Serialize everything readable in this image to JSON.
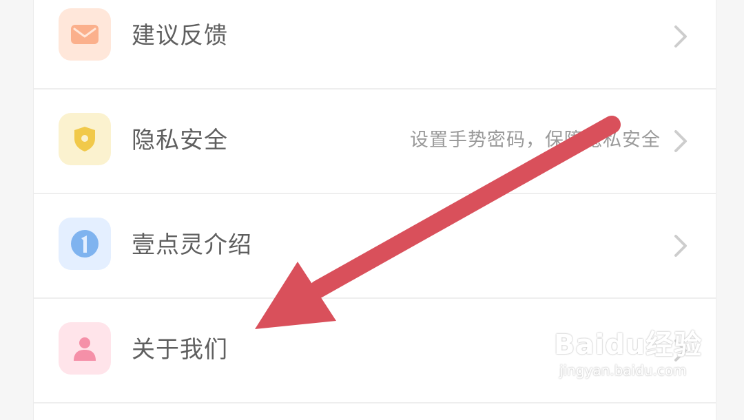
{
  "menu": {
    "items": [
      {
        "label": "建议反馈",
        "subtitle": "",
        "icon": "mail-icon",
        "icon_bg": "#ffe7da",
        "icon_color": "#fbb08c"
      },
      {
        "label": "隐私安全",
        "subtitle": "设置手势密码，保障隐私安全",
        "icon": "shield-icon",
        "icon_bg": "#fbf2cf",
        "icon_color": "#f1c94a"
      },
      {
        "label": "壹点灵介绍",
        "subtitle": "",
        "icon": "info-one-icon",
        "icon_bg": "#e4efff",
        "icon_color": "#7fb3ef"
      },
      {
        "label": "关于我们",
        "subtitle": "",
        "icon": "person-icon",
        "icon_bg": "#ffe4ea",
        "icon_color": "#f590a8"
      }
    ]
  },
  "annotation": {
    "arrow_color": "#d9505b"
  },
  "watermark": {
    "logo_text": "Baidu经验",
    "url": "jingyan.baidu.com"
  }
}
